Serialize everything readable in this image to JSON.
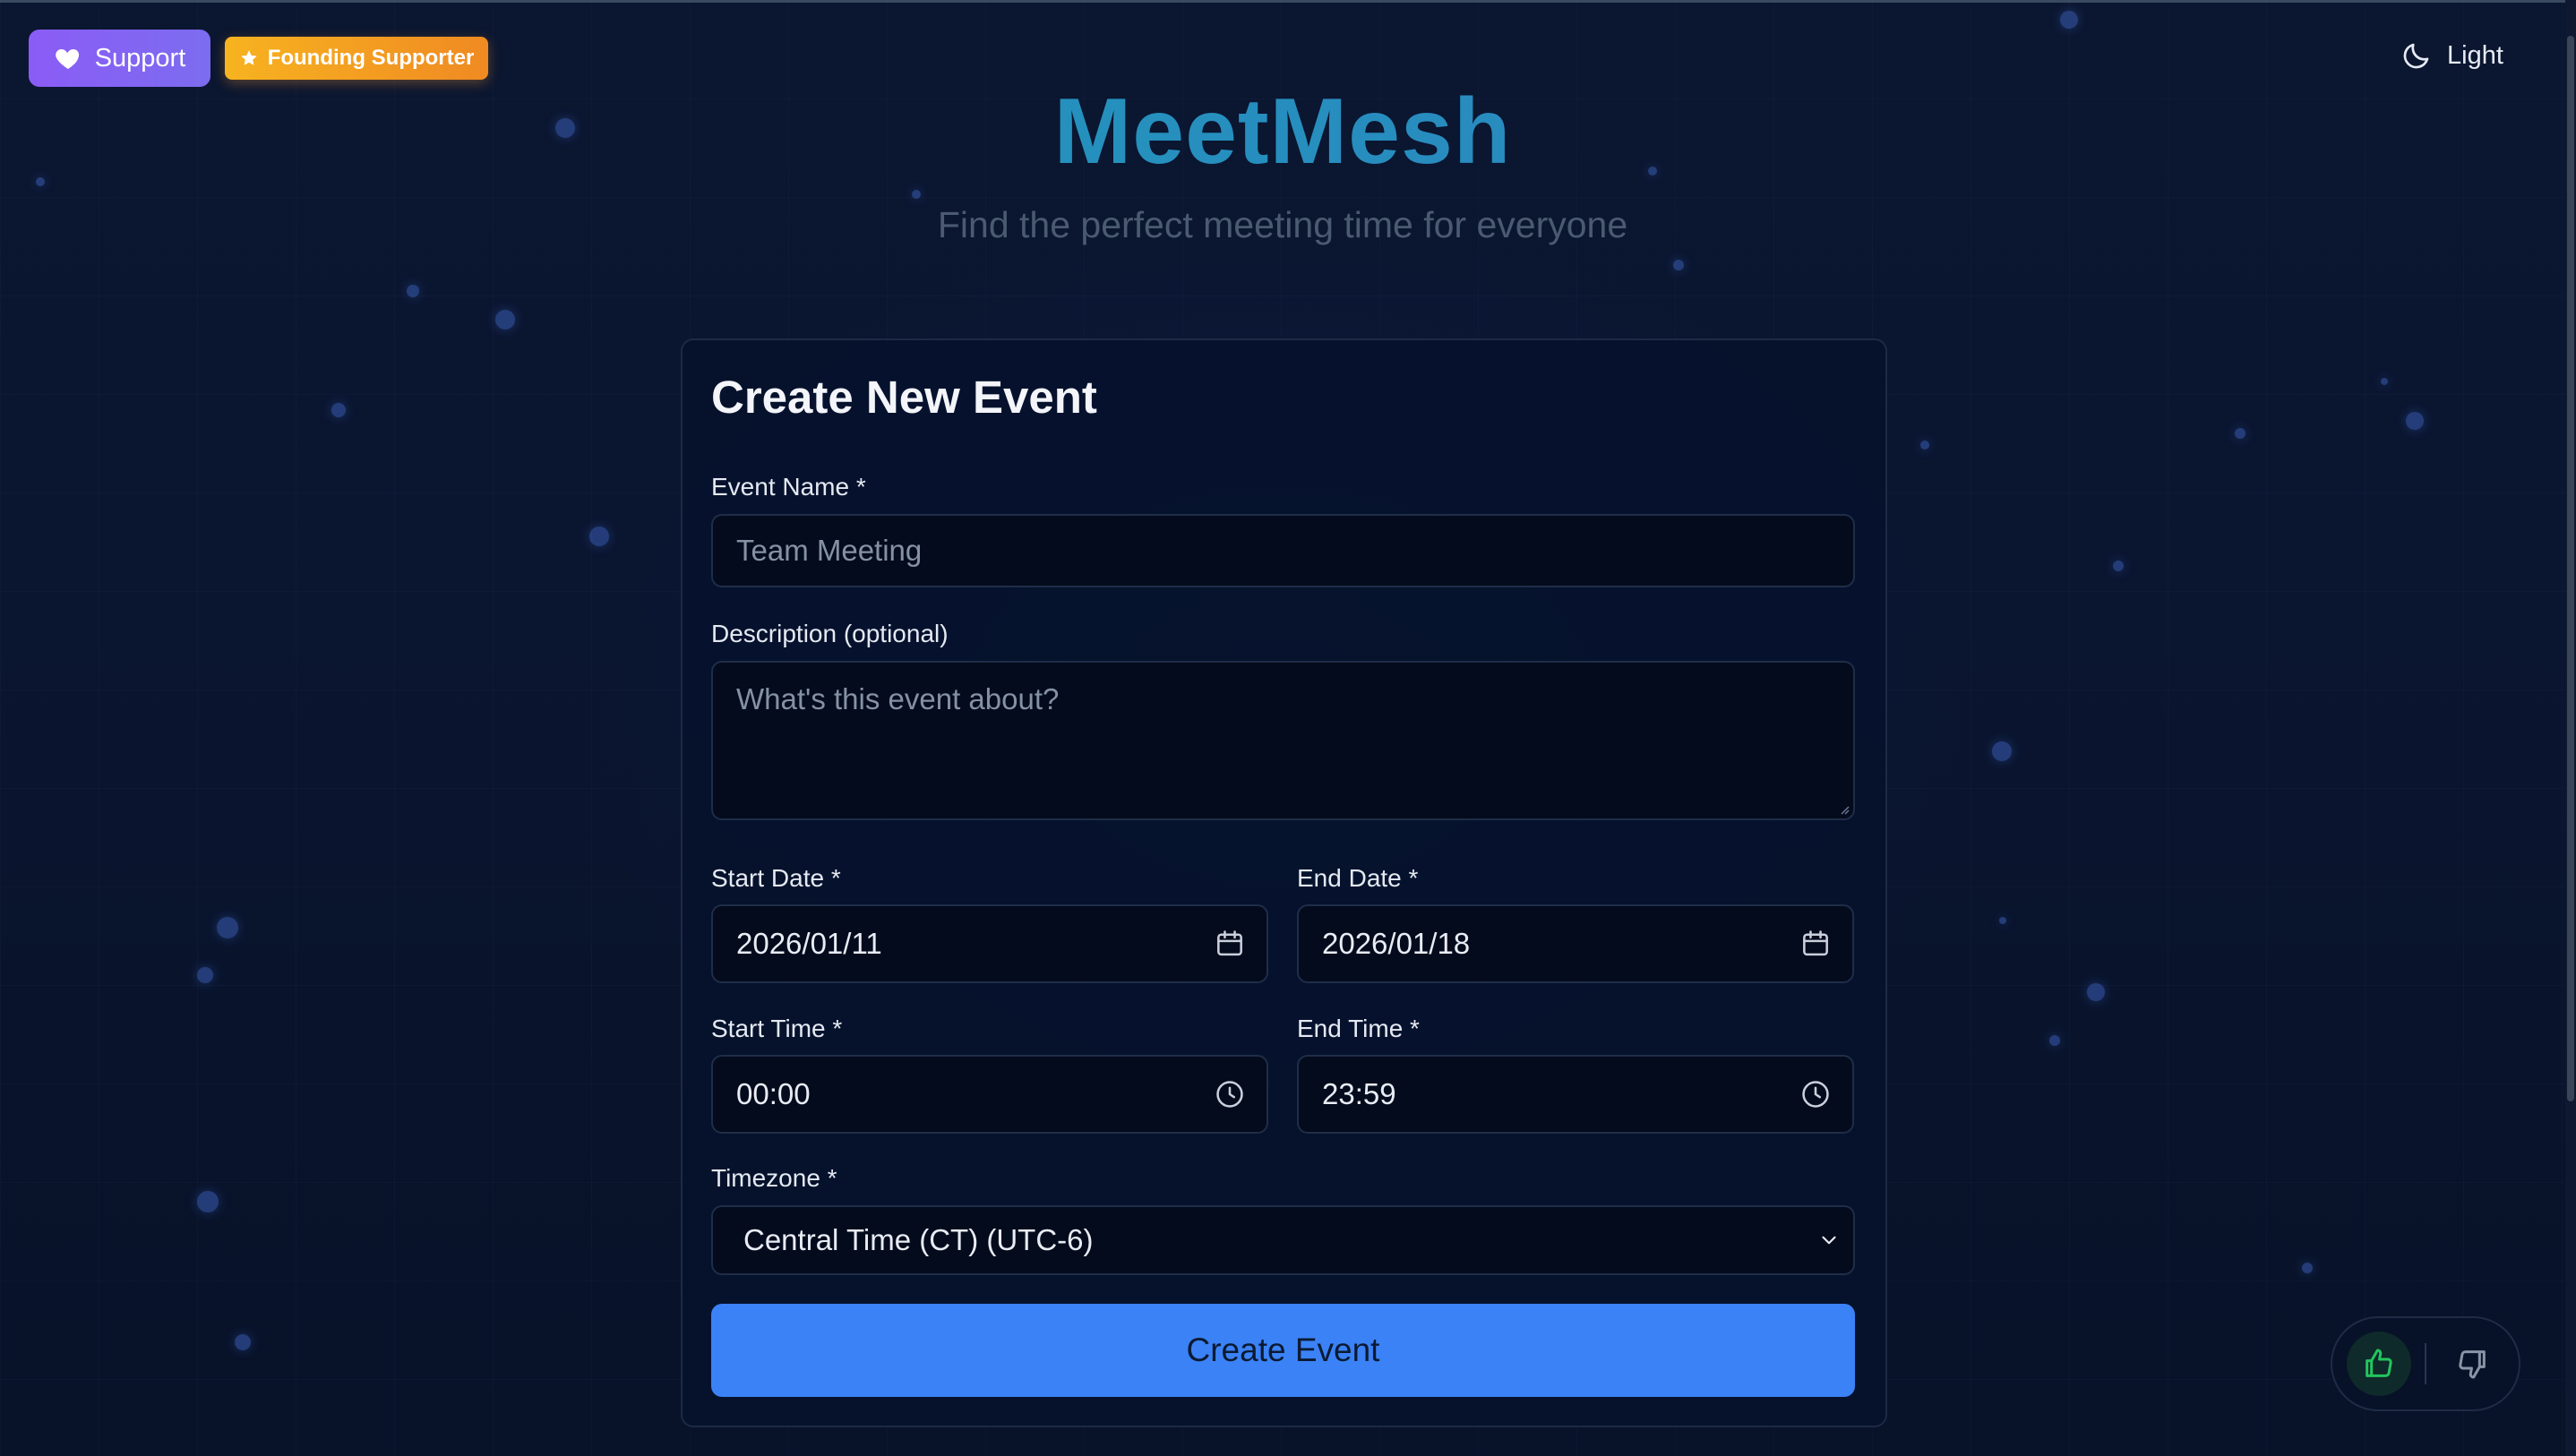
{
  "header": {
    "support_label": "Support",
    "founding_label": "Founding Supporter",
    "theme_label": "Light",
    "app_title": "MeetMesh",
    "app_subtitle": "Find the perfect meeting time for everyone"
  },
  "form": {
    "title": "Create New Event",
    "event_name": {
      "label": "Event Name *",
      "placeholder": "Team Meeting",
      "value": ""
    },
    "description": {
      "label": "Description (optional)",
      "placeholder": "What's this event about?",
      "value": ""
    },
    "start_date": {
      "label": "Start Date *",
      "value": "2026/01/11"
    },
    "end_date": {
      "label": "End Date *",
      "value": "2026/01/18"
    },
    "start_time": {
      "label": "Start Time *",
      "value": "00:00"
    },
    "end_time": {
      "label": "End Time *",
      "value": "23:59"
    },
    "timezone": {
      "label": "Timezone *",
      "selected": "Central Time (CT) (UTC-6)"
    },
    "submit_label": "Create Event"
  },
  "icons": {
    "support": "heart-icon",
    "founding": "star-icon",
    "theme": "moon-icon",
    "date": "calendar-icon",
    "time": "clock-icon",
    "select": "chevron-down-icon",
    "feedback_positive": "thumbs-up-icon",
    "feedback_negative": "thumbs-down-icon"
  },
  "colors": {
    "accent": "#3b82f6",
    "title_gradient_start": "#1e9db8",
    "title_gradient_end": "#2f7fc4",
    "support_purple": "#8b5cf6",
    "founding_orange": "#f7b320",
    "thumbs_up_green": "#22c55e",
    "background": "#0a1428"
  }
}
